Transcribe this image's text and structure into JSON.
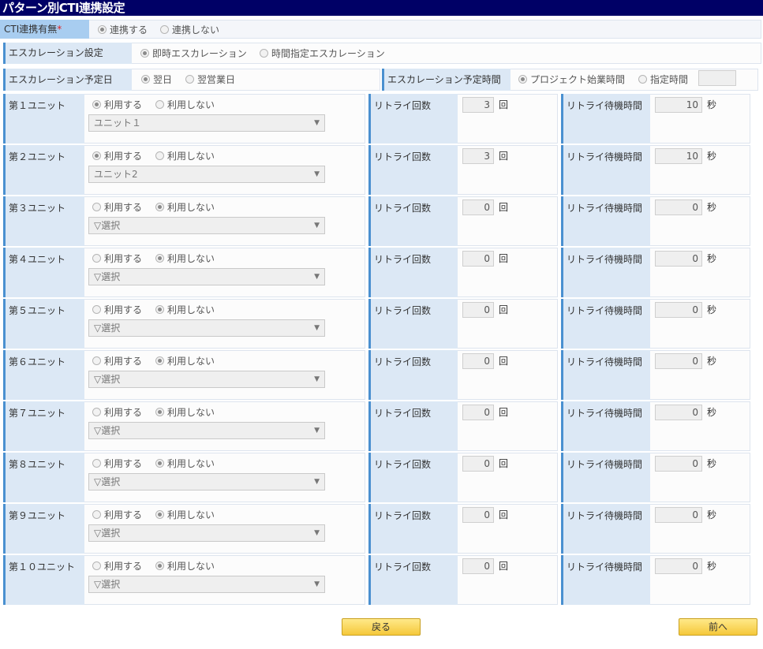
{
  "title": "パターン別CTI連携設定",
  "cti": {
    "label": "CTI連携有無",
    "required_mark": "*",
    "options": [
      "連携する",
      "連携しない"
    ],
    "selected": 0
  },
  "escalation": {
    "label": "エスカレーション設定",
    "options": [
      "即時エスカレーション",
      "時間指定エスカレーション"
    ],
    "selected": 0
  },
  "esc_day": {
    "label": "エスカレーション予定日",
    "options": [
      "翌日",
      "翌営業日"
    ],
    "selected": 0
  },
  "esc_time": {
    "label": "エスカレーション予定時間",
    "options": [
      "プロジェクト始業時間",
      "指定時間"
    ],
    "selected": 0,
    "value": ""
  },
  "labels": {
    "use": "利用する",
    "nouse": "利用しない",
    "retry_count": "リトライ回数",
    "retry_wait": "リトライ待機時間",
    "count_unit": "回",
    "sec_unit": "秒"
  },
  "units": [
    {
      "name": "第１ユニット",
      "use": true,
      "select": "ユニット１",
      "retry": "3",
      "wait": "10"
    },
    {
      "name": "第２ユニット",
      "use": true,
      "select": "ユニット2",
      "retry": "3",
      "wait": "10"
    },
    {
      "name": "第３ユニット",
      "use": false,
      "select": "▽選択",
      "retry": "0",
      "wait": "0"
    },
    {
      "name": "第４ユニット",
      "use": false,
      "select": "▽選択",
      "retry": "0",
      "wait": "0"
    },
    {
      "name": "第５ユニット",
      "use": false,
      "select": "▽選択",
      "retry": "0",
      "wait": "0"
    },
    {
      "name": "第６ユニット",
      "use": false,
      "select": "▽選択",
      "retry": "0",
      "wait": "0"
    },
    {
      "name": "第７ユニット",
      "use": false,
      "select": "▽選択",
      "retry": "0",
      "wait": "0"
    },
    {
      "name": "第８ユニット",
      "use": false,
      "select": "▽選択",
      "retry": "0",
      "wait": "0"
    },
    {
      "name": "第９ユニット",
      "use": false,
      "select": "▽選択",
      "retry": "0",
      "wait": "0"
    },
    {
      "name": "第１０ユニット",
      "use": false,
      "select": "▽選択",
      "retry": "0",
      "wait": "0"
    }
  ],
  "buttons": {
    "back": "戻る",
    "next": "前へ"
  }
}
